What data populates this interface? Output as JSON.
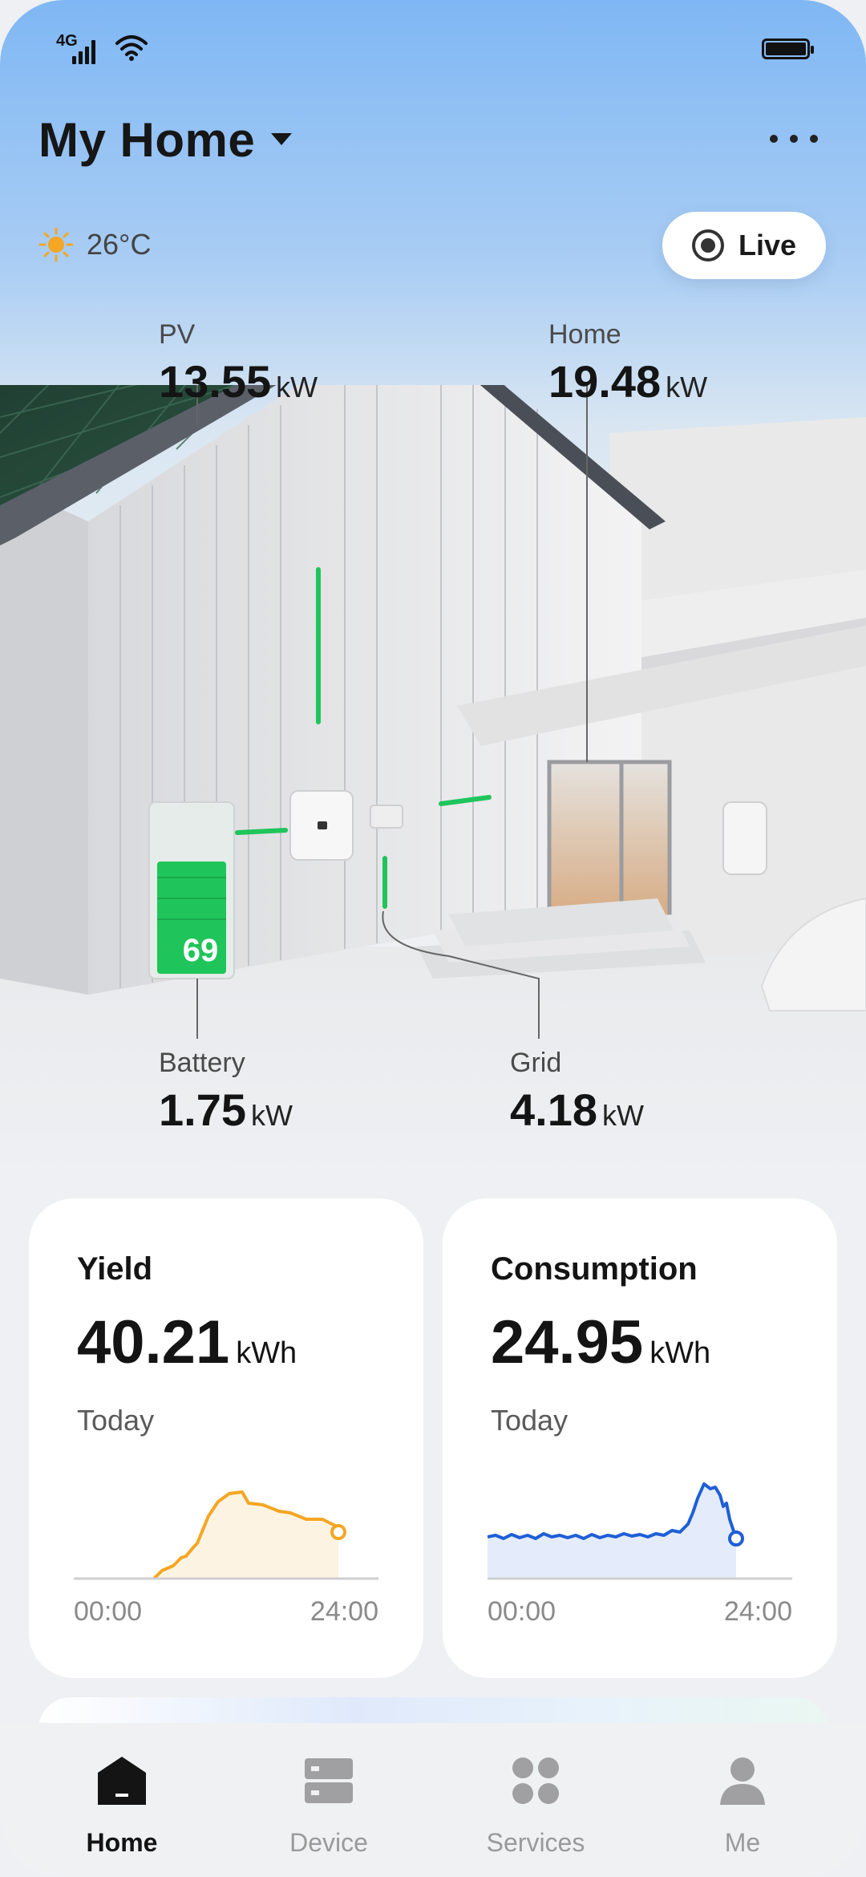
{
  "status_bar": {
    "network": "4G"
  },
  "header": {
    "title": "My Home",
    "more_icon": "more-dots-icon"
  },
  "weather": {
    "icon": "sun-icon",
    "temperature": "26°C"
  },
  "live_button": {
    "label": "Live",
    "icon": "live-record-icon"
  },
  "flows": {
    "pv": {
      "label": "PV",
      "value": "13.55",
      "unit": "kW"
    },
    "home": {
      "label": "Home",
      "value": "19.48",
      "unit": "kW"
    },
    "battery": {
      "label": "Battery",
      "value": "1.75",
      "unit": "kW",
      "soc": "69"
    },
    "grid": {
      "label": "Grid",
      "value": "4.18",
      "unit": "kW"
    }
  },
  "cards": {
    "yield": {
      "title": "Yield",
      "value": "40.21",
      "unit": "kWh",
      "period": "Today",
      "start": "00:00",
      "end": "24:00",
      "color": "#f5a623"
    },
    "consumption": {
      "title": "Consumption",
      "value": "24.95",
      "unit": "kWh",
      "period": "Today",
      "start": "00:00",
      "end": "24:00",
      "color": "#1f5fd6"
    }
  },
  "tabs": [
    {
      "label": "Home",
      "icon": "home-icon",
      "active": true
    },
    {
      "label": "Device",
      "icon": "device-icon",
      "active": false
    },
    {
      "label": "Services",
      "icon": "services-icon",
      "active": false
    },
    {
      "label": "Me",
      "icon": "person-icon",
      "active": false
    }
  ],
  "colors": {
    "accent_green": "#1fc55a",
    "yield_orange": "#f5a623",
    "consumption_blue": "#1f5fd6"
  }
}
